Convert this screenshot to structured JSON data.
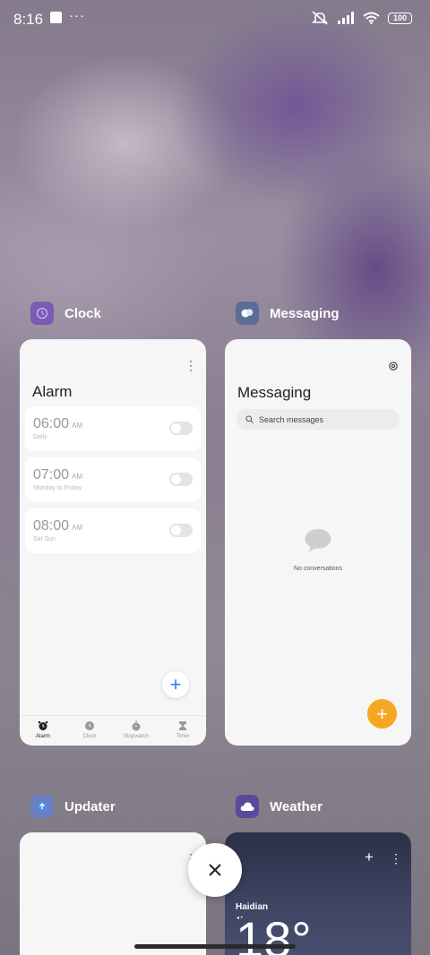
{
  "status": {
    "time": "8:16",
    "more": "···",
    "battery": "100"
  },
  "apps": [
    {
      "name": "Clock",
      "icon": "clock-app-icon",
      "color": "#7b5bb5"
    },
    {
      "name": "Messaging",
      "icon": "messaging-app-icon",
      "color": "#5b6d96"
    },
    {
      "name": "Updater",
      "icon": "updater-app-icon",
      "color": "#6a7ec0"
    },
    {
      "name": "Weather",
      "icon": "weather-app-icon",
      "color": "#5a4a9a"
    }
  ],
  "clock": {
    "title": "Alarm",
    "alarms": [
      {
        "time": "06:00",
        "ampm": "AM",
        "repeat": "Daily",
        "enabled": false
      },
      {
        "time": "07:00",
        "ampm": "AM",
        "repeat": "Monday to Friday",
        "enabled": false
      },
      {
        "time": "08:00",
        "ampm": "AM",
        "repeat": "Sat Sun",
        "enabled": false
      }
    ],
    "nav": [
      "Alarm",
      "Clock",
      "Stopwatch",
      "Timer"
    ]
  },
  "messaging": {
    "title": "Messaging",
    "search_placeholder": "Search messages",
    "empty": "No conversations"
  },
  "weather": {
    "location": "Haidian",
    "temp": "18°"
  },
  "colors": {
    "accent_blue": "#2b7cf6",
    "accent_orange": "#f5a623"
  }
}
